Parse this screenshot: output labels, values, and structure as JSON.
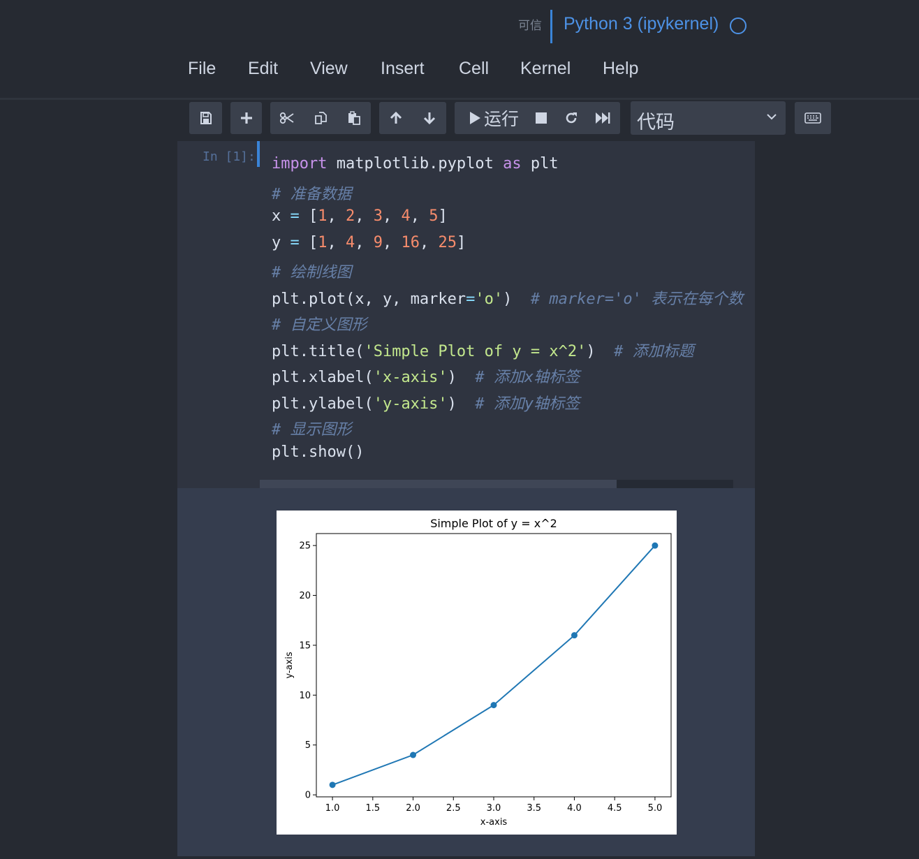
{
  "header": {
    "trusted_label": "可信",
    "kernel_name": "Python 3 (ipykernel)"
  },
  "menu": [
    "File",
    "Edit",
    "View",
    "Insert",
    "Cell",
    "Kernel",
    "Help"
  ],
  "toolbar": {
    "run_label": "运行",
    "cell_type": "代码",
    "icons": [
      "save-icon",
      "plus-icon",
      "scissors-icon",
      "copy-icon",
      "paste-icon",
      "arrow-up-icon",
      "arrow-down-icon",
      "play-icon",
      "stop-icon",
      "restart-icon",
      "fast-forward-icon",
      "chevron-down-icon",
      "keyboard-icon"
    ]
  },
  "cell": {
    "prompt": "In [1]:",
    "code_lines": [
      [
        {
          "t": "import",
          "c": "kw"
        },
        {
          "t": " matplotlib.pyplot "
        },
        {
          "t": "as",
          "c": "kw"
        },
        {
          "t": " plt"
        }
      ],
      [
        {
          "t": "# 准备数据",
          "c": "cm"
        }
      ],
      [
        {
          "t": "x "
        },
        {
          "t": "=",
          "c": "op"
        },
        {
          "t": " ["
        },
        {
          "t": "1",
          "c": "num"
        },
        {
          "t": ", "
        },
        {
          "t": "2",
          "c": "num"
        },
        {
          "t": ", "
        },
        {
          "t": "3",
          "c": "num"
        },
        {
          "t": ", "
        },
        {
          "t": "4",
          "c": "num"
        },
        {
          "t": ", "
        },
        {
          "t": "5",
          "c": "num"
        },
        {
          "t": "]"
        }
      ],
      [
        {
          "t": "y "
        },
        {
          "t": "=",
          "c": "op"
        },
        {
          "t": " ["
        },
        {
          "t": "1",
          "c": "num"
        },
        {
          "t": ", "
        },
        {
          "t": "4",
          "c": "num"
        },
        {
          "t": ", "
        },
        {
          "t": "9",
          "c": "num"
        },
        {
          "t": ", "
        },
        {
          "t": "16",
          "c": "num"
        },
        {
          "t": ", "
        },
        {
          "t": "25",
          "c": "num"
        },
        {
          "t": "]"
        }
      ],
      [
        {
          "t": "# 绘制线图",
          "c": "cm"
        }
      ],
      [
        {
          "t": "plt.plot(x, y, marker"
        },
        {
          "t": "=",
          "c": "op"
        },
        {
          "t": "'o'",
          "c": "str"
        },
        {
          "t": ")  "
        },
        {
          "t": "# marker='o' 表示在每个数",
          "c": "cm"
        }
      ],
      [
        {
          "t": "# 自定义图形",
          "c": "cm"
        }
      ],
      [
        {
          "t": "plt.title("
        },
        {
          "t": "'Simple Plot of y = x^2'",
          "c": "str"
        },
        {
          "t": ")  "
        },
        {
          "t": "# 添加标题",
          "c": "cm"
        }
      ],
      [
        {
          "t": "plt.xlabel("
        },
        {
          "t": "'x-axis'",
          "c": "str"
        },
        {
          "t": ")  "
        },
        {
          "t": "# 添加x轴标签",
          "c": "cm"
        }
      ],
      [
        {
          "t": "plt.ylabel("
        },
        {
          "t": "'y-axis'",
          "c": "str"
        },
        {
          "t": ")  "
        },
        {
          "t": "# 添加y轴标签",
          "c": "cm"
        }
      ],
      [
        {
          "t": "# 显示图形",
          "c": "cm"
        }
      ],
      [
        {
          "t": "plt.show()"
        }
      ]
    ]
  },
  "chart_data": {
    "type": "line",
    "title": "Simple Plot of y = x^2",
    "xlabel": "x-axis",
    "ylabel": "y-axis",
    "x": [
      1,
      2,
      3,
      4,
      5
    ],
    "y": [
      1,
      4,
      9,
      16,
      25
    ],
    "marker": "o",
    "color": "#1f77b4",
    "xlim": [
      0.8,
      5.2
    ],
    "ylim": [
      -0.2,
      26.2
    ],
    "xticks": [
      "1.0",
      "1.5",
      "2.0",
      "2.5",
      "3.0",
      "3.5",
      "4.0",
      "4.5",
      "5.0"
    ],
    "yticks": [
      "0",
      "5",
      "10",
      "15",
      "20",
      "25"
    ],
    "grid": false
  }
}
